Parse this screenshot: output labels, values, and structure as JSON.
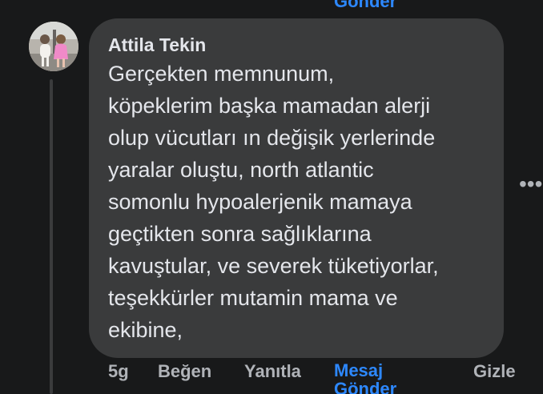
{
  "previous_comment": {
    "message_link_tail": "Gönder"
  },
  "comment": {
    "author": "Attila Tekin",
    "avatar_icon": "profile-photo-two-children",
    "text": "Gerçekten memnunum,\nköpeklerim başka mamadan alerji\nolup vücutları ın değişik yerlerinde\nyaralar oluştu, north atlantic\nsomonlu hypoalerjenik mamaya\ngeçtikten sonra sağlıklarına\nkavuştular, ve severek tüketiyorlar,\nteşekkürler mutamin mama ve\nekibine,",
    "more_icon": "ellipsis-horizontal-icon"
  },
  "actions": {
    "time": "5g",
    "like": "Beğen",
    "reply": "Yanıtla",
    "message_line1": "Mesaj",
    "message_line2": "Gönder",
    "hide": "Gizle"
  },
  "colors": {
    "background": "#18191a",
    "bubble": "#3a3b3c",
    "primary_text": "#e4e6eb",
    "secondary_text": "#b0b3b8",
    "accent": "#2d88ff"
  }
}
